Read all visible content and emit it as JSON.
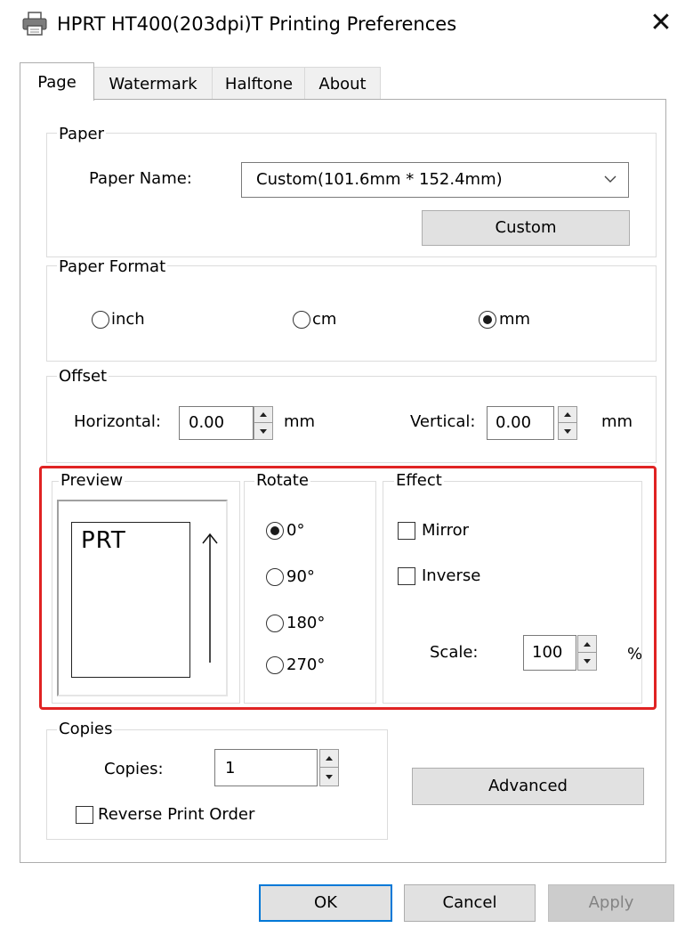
{
  "window": {
    "title": "HPRT HT400(203dpi)T Printing Preferences",
    "close_symbol": "✕",
    "icon": "printer-icon"
  },
  "tabs": [
    {
      "label": "Page",
      "active": true
    },
    {
      "label": "Watermark",
      "active": false
    },
    {
      "label": "Halftone",
      "active": false
    },
    {
      "label": "About",
      "active": false
    }
  ],
  "paper": {
    "group_label": "Paper",
    "name_label": "Paper Name:",
    "selected": "Custom(101.6mm * 152.4mm)",
    "custom_button": "Custom"
  },
  "paper_format": {
    "group_label": "Paper Format",
    "options": [
      {
        "label": "inch",
        "checked": false
      },
      {
        "label": "cm",
        "checked": false
      },
      {
        "label": "mm",
        "checked": true
      }
    ]
  },
  "offset": {
    "group_label": "Offset",
    "horizontal_label": "Horizontal:",
    "horizontal_value": "0.00",
    "horizontal_unit": "mm",
    "vertical_label": "Vertical:",
    "vertical_value": "0.00",
    "vertical_unit": "mm"
  },
  "preview": {
    "group_label": "Preview",
    "sample_text": "PRT"
  },
  "rotate": {
    "group_label": "Rotate",
    "options": [
      {
        "label": "0°",
        "checked": true
      },
      {
        "label": "90°",
        "checked": false
      },
      {
        "label": "180°",
        "checked": false
      },
      {
        "label": "270°",
        "checked": false
      }
    ]
  },
  "effect": {
    "group_label": "Effect",
    "mirror_label": "Mirror",
    "mirror_checked": false,
    "inverse_label": "Inverse",
    "inverse_checked": false,
    "scale_label": "Scale:",
    "scale_value": "100",
    "scale_unit": "%"
  },
  "copies": {
    "group_label": "Copies",
    "copies_label": "Copies:",
    "copies_value": "1",
    "reverse_label": "Reverse Print Order",
    "reverse_checked": false
  },
  "buttons": {
    "advanced": "Advanced",
    "ok": "OK",
    "cancel": "Cancel",
    "apply": "Apply"
  },
  "colors": {
    "highlight": "#e02323",
    "ok_border": "#0078d7"
  }
}
